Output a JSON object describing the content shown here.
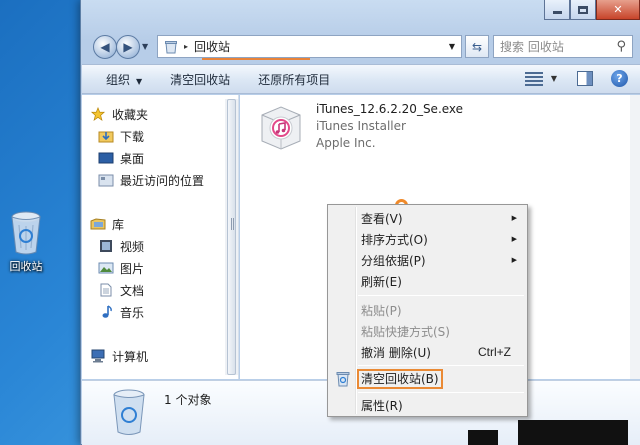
{
  "desktop": {
    "recycle_bin_label": "回收站"
  },
  "window": {
    "address": {
      "path": "回收站",
      "arrow": "▸"
    },
    "search": {
      "placeholder": "搜索 回收站"
    }
  },
  "toolbar": {
    "organize": "组织",
    "empty_bin": "清空回收站",
    "restore_all": "还原所有项目",
    "help": "?"
  },
  "nav": {
    "favorites": "收藏夹",
    "downloads": "下载",
    "desktop": "桌面",
    "recent": "最近访问的位置",
    "libraries": "库",
    "videos": "视频",
    "pictures": "图片",
    "documents": "文档",
    "music": "音乐",
    "computer": "计算机"
  },
  "file": {
    "name": "iTunes_12.6.2.20_Se.exe",
    "description": "iTunes Installer",
    "company": "Apple Inc."
  },
  "details": {
    "count": "1 个对象"
  },
  "context_menu": {
    "view": "查看(V)",
    "sort": "排序方式(O)",
    "group": "分组依据(P)",
    "refresh": "刷新(E)",
    "paste": "粘贴(P)",
    "paste_shortcut": "粘贴快捷方式(S)",
    "undo_delete": "撤消 删除(U)",
    "undo_shortcut": "Ctrl+Z",
    "empty_bin": "清空回收站(B)",
    "properties": "属性(R)"
  },
  "colors": {
    "highlight_border": "#ea8a35",
    "accent_blue": "#1f56a8"
  }
}
